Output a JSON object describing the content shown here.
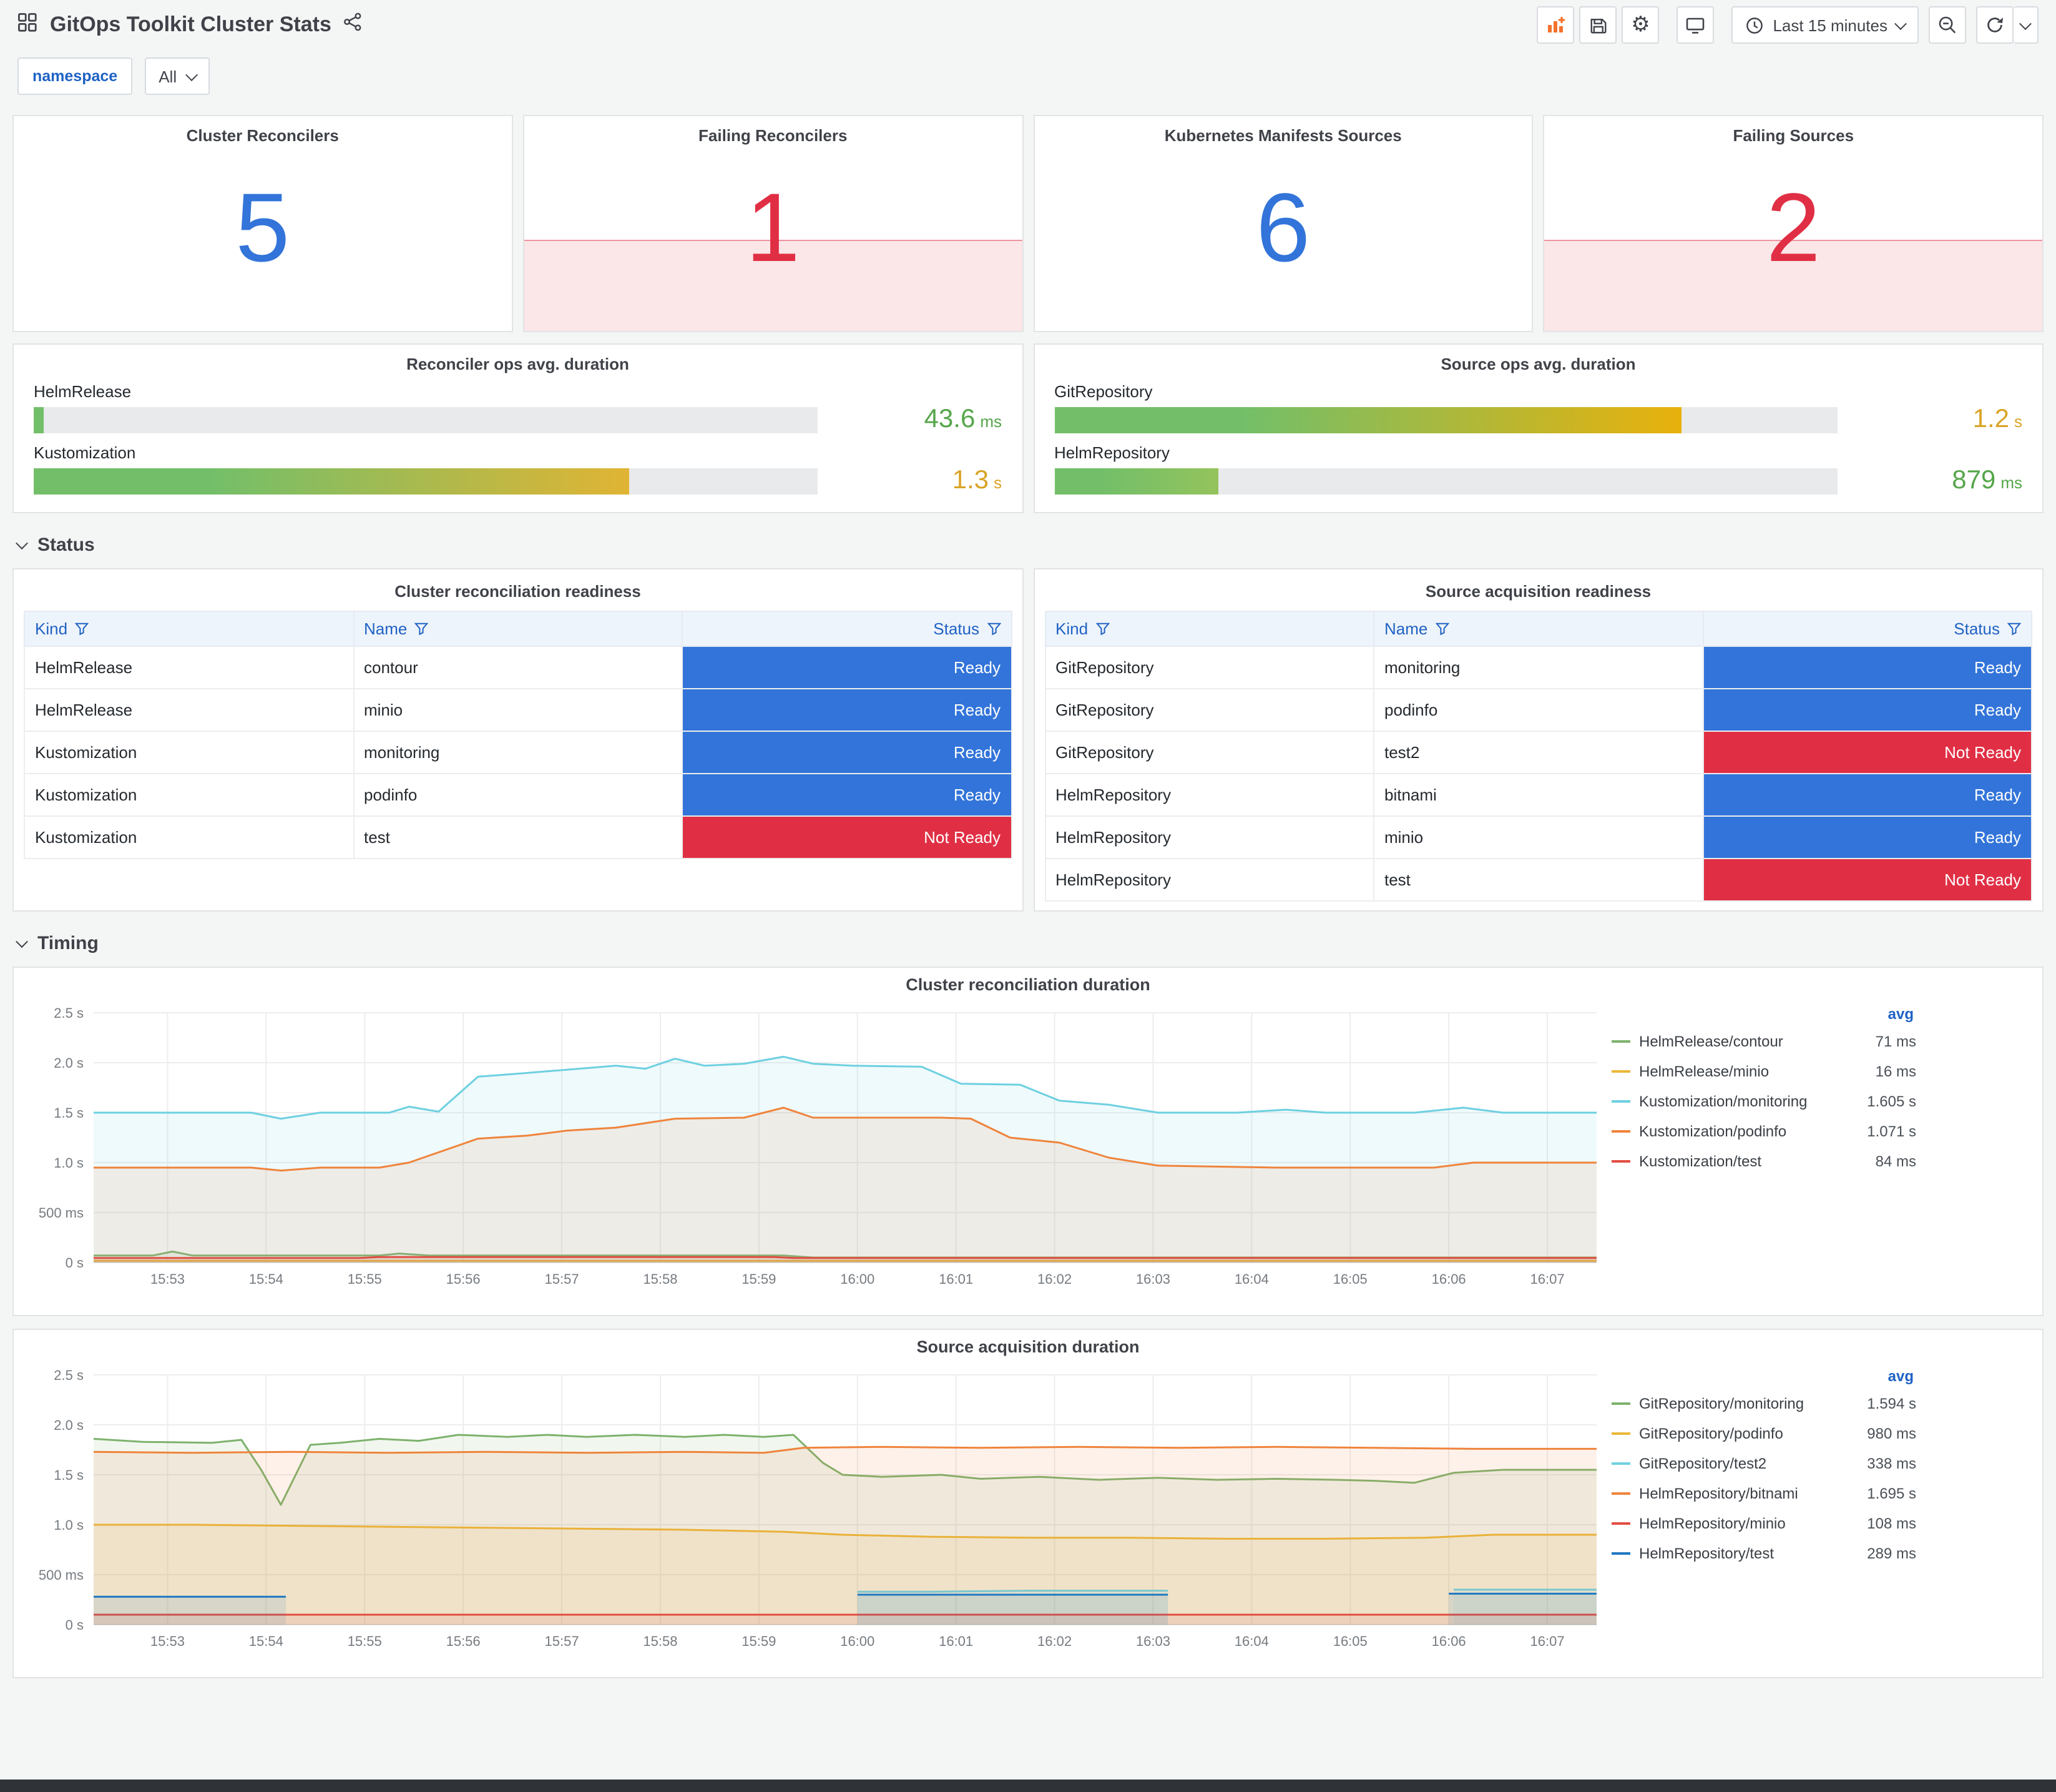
{
  "header": {
    "title": "GitOps Toolkit Cluster Stats",
    "time_range": "Last 15 minutes"
  },
  "filters": {
    "namespace_label": "namespace",
    "namespace_value": "All"
  },
  "sections": {
    "status": "Status",
    "timing": "Timing"
  },
  "colors": {
    "blue": "#3274D9",
    "red": "#E02F44",
    "green_text": "#56A64B",
    "yellow_text": "#D9A427"
  },
  "stats": [
    {
      "title": "Cluster Reconcilers",
      "value": "5",
      "color": "#3274D9",
      "failing": false
    },
    {
      "title": "Failing Reconcilers",
      "value": "1",
      "color": "#E02F44",
      "failing": true
    },
    {
      "title": "Kubernetes Manifests Sources",
      "value": "6",
      "color": "#3274D9",
      "failing": false
    },
    {
      "title": "Failing Sources",
      "value": "2",
      "color": "#E02F44",
      "failing": true
    }
  ],
  "gauges": [
    {
      "title": "Reconciler ops avg. duration",
      "bars": [
        {
          "label": "HelmRelease",
          "percent": 1.3,
          "value": "43.6",
          "unit": "ms",
          "value_color": "#56A64B",
          "gradient": [
            "#73BF69",
            "#73BF69"
          ]
        },
        {
          "label": "Kustomization",
          "percent": 76,
          "value": "1.3",
          "unit": "s",
          "value_color": "#D9A427",
          "gradient": [
            "#73BF69",
            "#E0B434"
          ]
        }
      ]
    },
    {
      "title": "Source ops avg. duration",
      "bars": [
        {
          "label": "GitRepository",
          "percent": 80,
          "value": "1.2",
          "unit": "s",
          "value_color": "#D9A427",
          "gradient": [
            "#73BF69",
            "#E8B10C"
          ]
        },
        {
          "label": "HelmRepository",
          "percent": 21,
          "value": "879",
          "unit": "ms",
          "value_color": "#56A64B",
          "gradient": [
            "#73BF69",
            "#94C35C"
          ]
        }
      ]
    }
  ],
  "status_colors": {
    "Ready": "#3274D9",
    "Not Ready": "#E02F44"
  },
  "tables": [
    {
      "title": "Cluster reconciliation readiness",
      "columns": [
        "Kind",
        "Name",
        "Status"
      ],
      "rows": [
        {
          "kind": "HelmRelease",
          "name": "contour",
          "status": "Ready"
        },
        {
          "kind": "HelmRelease",
          "name": "minio",
          "status": "Ready"
        },
        {
          "kind": "Kustomization",
          "name": "monitoring",
          "status": "Ready"
        },
        {
          "kind": "Kustomization",
          "name": "podinfo",
          "status": "Ready"
        },
        {
          "kind": "Kustomization",
          "name": "test",
          "status": "Not Ready"
        }
      ]
    },
    {
      "title": "Source acquisition readiness",
      "columns": [
        "Kind",
        "Name",
        "Status"
      ],
      "rows": [
        {
          "kind": "GitRepository",
          "name": "monitoring",
          "status": "Ready"
        },
        {
          "kind": "GitRepository",
          "name": "podinfo",
          "status": "Ready"
        },
        {
          "kind": "GitRepository",
          "name": "test2",
          "status": "Not Ready"
        },
        {
          "kind": "HelmRepository",
          "name": "bitnami",
          "status": "Ready"
        },
        {
          "kind": "HelmRepository",
          "name": "minio",
          "status": "Ready"
        },
        {
          "kind": "HelmRepository",
          "name": "test",
          "status": "Not Ready"
        }
      ]
    }
  ],
  "chart_data": [
    {
      "type": "line",
      "title": "Cluster reconciliation duration",
      "legend_header": "avg",
      "ylim": [
        0,
        2.5
      ],
      "y_ticks": [
        "0 s",
        "500 ms",
        "1.0 s",
        "1.5 s",
        "2.0 s",
        "2.5 s"
      ],
      "x_ticks": [
        "15:53",
        "15:54",
        "15:55",
        "15:56",
        "15:57",
        "15:58",
        "15:59",
        "16:00",
        "16:01",
        "16:02",
        "16:03",
        "16:04",
        "16:05",
        "16:06",
        "16:07"
      ],
      "x_domain": [
        0,
        15.25
      ],
      "x_tick_start": 0.75,
      "series": [
        {
          "name": "HelmRelease/contour",
          "avg": "71 ms",
          "color": "#7EB26D",
          "points": [
            [
              0,
              0.07
            ],
            [
              0.6,
              0.07
            ],
            [
              0.8,
              0.11
            ],
            [
              1.0,
              0.07
            ],
            [
              2.9,
              0.07
            ],
            [
              3.1,
              0.09
            ],
            [
              3.4,
              0.07
            ],
            [
              7.0,
              0.07
            ],
            [
              7.3,
              0.05
            ],
            [
              15.25,
              0.05
            ]
          ]
        },
        {
          "name": "HelmRelease/minio",
          "avg": "16 ms",
          "color": "#EAB839",
          "points": [
            [
              0,
              0.018
            ],
            [
              15.25,
              0.018
            ]
          ]
        },
        {
          "name": "Kustomization/monitoring",
          "avg": "1.605 s",
          "color": "#6ED0E0",
          "points": [
            [
              0,
              1.5
            ],
            [
              1.6,
              1.5
            ],
            [
              1.9,
              1.44
            ],
            [
              2.3,
              1.5
            ],
            [
              3.0,
              1.5
            ],
            [
              3.2,
              1.56
            ],
            [
              3.5,
              1.51
            ],
            [
              3.9,
              1.86
            ],
            [
              4.3,
              1.89
            ],
            [
              4.8,
              1.93
            ],
            [
              5.3,
              1.97
            ],
            [
              5.6,
              1.94
            ],
            [
              5.9,
              2.04
            ],
            [
              6.2,
              1.97
            ],
            [
              6.6,
              1.99
            ],
            [
              7.0,
              2.06
            ],
            [
              7.3,
              1.99
            ],
            [
              7.7,
              1.97
            ],
            [
              8.4,
              1.96
            ],
            [
              8.8,
              1.79
            ],
            [
              9.4,
              1.78
            ],
            [
              9.8,
              1.62
            ],
            [
              10.3,
              1.58
            ],
            [
              10.8,
              1.5
            ],
            [
              11.6,
              1.5
            ],
            [
              12.1,
              1.53
            ],
            [
              12.5,
              1.5
            ],
            [
              13.4,
              1.5
            ],
            [
              13.9,
              1.55
            ],
            [
              14.3,
              1.5
            ],
            [
              15.25,
              1.5
            ]
          ]
        },
        {
          "name": "Kustomization/podinfo",
          "avg": "1.071 s",
          "color": "#EF843C",
          "points": [
            [
              0,
              0.95
            ],
            [
              1.6,
              0.95
            ],
            [
              1.9,
              0.92
            ],
            [
              2.3,
              0.95
            ],
            [
              2.9,
              0.95
            ],
            [
              3.2,
              1.0
            ],
            [
              3.9,
              1.24
            ],
            [
              4.4,
              1.27
            ],
            [
              4.8,
              1.32
            ],
            [
              5.3,
              1.35
            ],
            [
              5.9,
              1.44
            ],
            [
              6.6,
              1.45
            ],
            [
              7.0,
              1.55
            ],
            [
              7.3,
              1.45
            ],
            [
              8.6,
              1.45
            ],
            [
              8.9,
              1.44
            ],
            [
              9.3,
              1.25
            ],
            [
              9.8,
              1.2
            ],
            [
              10.3,
              1.05
            ],
            [
              10.8,
              0.97
            ],
            [
              12.0,
              0.95
            ],
            [
              13.6,
              0.95
            ],
            [
              14.0,
              1.0
            ],
            [
              15.25,
              1.0
            ]
          ]
        },
        {
          "name": "Kustomization/test",
          "avg": "84 ms",
          "color": "#E24D42",
          "points": [
            [
              0,
              0.045
            ],
            [
              2.7,
              0.045
            ],
            [
              2.9,
              0.055
            ],
            [
              6.9,
              0.055
            ],
            [
              7.1,
              0.045
            ],
            [
              15.25,
              0.045
            ]
          ]
        }
      ]
    },
    {
      "type": "line",
      "title": "Source acquisition duration",
      "legend_header": "avg",
      "ylim": [
        0,
        2.5
      ],
      "y_ticks": [
        "0 s",
        "500 ms",
        "1.0 s",
        "1.5 s",
        "2.0 s",
        "2.5 s"
      ],
      "x_ticks": [
        "15:53",
        "15:54",
        "15:55",
        "15:56",
        "15:57",
        "15:58",
        "15:59",
        "16:00",
        "16:01",
        "16:02",
        "16:03",
        "16:04",
        "16:05",
        "16:06",
        "16:07"
      ],
      "x_domain": [
        0,
        15.25
      ],
      "x_tick_start": 0.75,
      "series": [
        {
          "name": "GitRepository/monitoring",
          "avg": "1.594 s",
          "color": "#7EB26D",
          "points": [
            [
              0,
              1.86
            ],
            [
              0.5,
              1.83
            ],
            [
              1.2,
              1.82
            ],
            [
              1.5,
              1.85
            ],
            [
              1.7,
              1.55
            ],
            [
              1.9,
              1.2
            ],
            [
              2.2,
              1.8
            ],
            [
              2.5,
              1.82
            ],
            [
              2.9,
              1.86
            ],
            [
              3.3,
              1.84
            ],
            [
              3.7,
              1.9
            ],
            [
              4.2,
              1.88
            ],
            [
              4.6,
              1.9
            ],
            [
              5.0,
              1.88
            ],
            [
              5.5,
              1.9
            ],
            [
              6.0,
              1.88
            ],
            [
              6.4,
              1.9
            ],
            [
              6.8,
              1.88
            ],
            [
              7.1,
              1.9
            ],
            [
              7.4,
              1.62
            ],
            [
              7.6,
              1.5
            ],
            [
              8.0,
              1.48
            ],
            [
              8.6,
              1.5
            ],
            [
              9.0,
              1.46
            ],
            [
              9.6,
              1.48
            ],
            [
              10.2,
              1.45
            ],
            [
              10.8,
              1.47
            ],
            [
              11.4,
              1.45
            ],
            [
              12.0,
              1.46
            ],
            [
              12.6,
              1.45
            ],
            [
              13.0,
              1.44
            ],
            [
              13.4,
              1.42
            ],
            [
              13.8,
              1.52
            ],
            [
              14.3,
              1.55
            ],
            [
              15.25,
              1.55
            ]
          ]
        },
        {
          "name": "GitRepository/podinfo",
          "avg": "980 ms",
          "color": "#EAB839",
          "points": [
            [
              0,
              1.0
            ],
            [
              1,
              1.0
            ],
            [
              2,
              0.99
            ],
            [
              3,
              0.98
            ],
            [
              4,
              0.97
            ],
            [
              5,
              0.96
            ],
            [
              6,
              0.95
            ],
            [
              7,
              0.93
            ],
            [
              7.6,
              0.9
            ],
            [
              8.5,
              0.88
            ],
            [
              9.5,
              0.87
            ],
            [
              10.5,
              0.87
            ],
            [
              11.5,
              0.86
            ],
            [
              12.5,
              0.86
            ],
            [
              13.5,
              0.87
            ],
            [
              14.2,
              0.9
            ],
            [
              15.25,
              0.9
            ]
          ]
        },
        {
          "name": "GitRepository/test2",
          "avg": "338 ms",
          "color": "#6ED0E0",
          "points": [
            [
              7.75,
              0.33
            ],
            [
              8.5,
              0.33
            ],
            [
              9.5,
              0.34
            ],
            [
              10.9,
              0.34
            ],
            [
              10.9,
              null
            ],
            [
              13.8,
              0.35
            ],
            [
              15.25,
              0.35
            ]
          ]
        },
        {
          "name": "HelmRepository/bitnami",
          "avg": "1.695 s",
          "color": "#EF843C",
          "points": [
            [
              0,
              1.73
            ],
            [
              1,
              1.72
            ],
            [
              2,
              1.73
            ],
            [
              3,
              1.72
            ],
            [
              4,
              1.73
            ],
            [
              5,
              1.72
            ],
            [
              6,
              1.73
            ],
            [
              6.8,
              1.72
            ],
            [
              7.2,
              1.77
            ],
            [
              8,
              1.78
            ],
            [
              9,
              1.77
            ],
            [
              10,
              1.78
            ],
            [
              11,
              1.77
            ],
            [
              12,
              1.78
            ],
            [
              13,
              1.77
            ],
            [
              14,
              1.76
            ],
            [
              15.25,
              1.76
            ]
          ]
        },
        {
          "name": "HelmRepository/minio",
          "avg": "108 ms",
          "color": "#E24D42",
          "points": [
            [
              0,
              0.1
            ],
            [
              15.25,
              0.1
            ]
          ]
        },
        {
          "name": "HelmRepository/test",
          "avg": "289 ms",
          "color": "#1F78C1",
          "points": [
            [
              0,
              0.28
            ],
            [
              1.95,
              0.28
            ],
            [
              1.95,
              null
            ],
            [
              7.75,
              0.3
            ],
            [
              10.9,
              0.3
            ],
            [
              10.9,
              null
            ],
            [
              13.75,
              0.31
            ],
            [
              15.25,
              0.31
            ]
          ]
        }
      ]
    }
  ]
}
